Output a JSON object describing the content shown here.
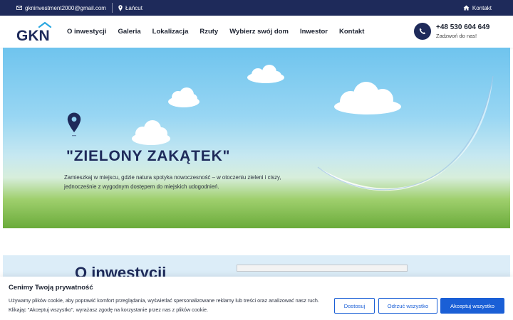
{
  "topbar": {
    "email": "gkninvestment2000@gmail.com",
    "location": "Łańcut",
    "contact": "Kontakt"
  },
  "header": {
    "logo_text": "GKN",
    "nav": [
      "O inwestycji",
      "Galeria",
      "Lokalizacja",
      "Rzuty",
      "Wybierz swój dom",
      "Inwestor",
      "Kontakt"
    ],
    "phone": "+48 530 604 649",
    "phone_sub": "Zadzwoń do nas!"
  },
  "hero": {
    "title": "\"ZIELONY ZAKĄTEK\"",
    "description": "Zamieszkaj w miejscu, gdzie natura spotyka nowoczesność – w otoczeniu zieleni i ciszy, jednocześnie z wygodnym dostępem do miejskich udogodnień."
  },
  "section": {
    "title": "O inwestycji"
  },
  "cookie": {
    "title": "Cenimy Twoją prywatność",
    "text": "Używamy plików cookie, aby poprawić komfort przeglądania, wyświetlać spersonalizowane reklamy lub treści oraz analizować nasz ruch. Klikając \"Akceptuj wszystko\", wyrażasz zgodę na korzystanie przez nas z plików cookie.",
    "customize": "Dostosuj",
    "reject": "Odrzuć wszystko",
    "accept": "Akceptuj wszystko"
  },
  "colors": {
    "navy": "#1e2a5a",
    "accent_blue": "#1a5fd6",
    "grass": "#6aab3a",
    "sky": "#6fc4ee"
  },
  "icons": {
    "email": "mail-icon",
    "location": "map-pin-icon",
    "contact": "house-icon",
    "phone": "phone-icon",
    "hero": "location-marker-icon"
  }
}
